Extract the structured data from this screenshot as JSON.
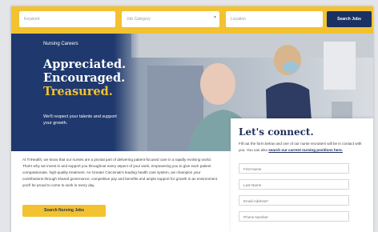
{
  "search_bar": {
    "keyword_placeholder": "Keyword",
    "category_placeholder": "Job Category",
    "location_placeholder": "Location",
    "search_button": "Search Jobs"
  },
  "hero": {
    "eyebrow": "Nursing Careers",
    "headline_1": "Appreciated.",
    "headline_2": "Encouraged.",
    "headline_3": "Treasured.",
    "subtext": "We'll respect your talents and support your growth."
  },
  "intro": {
    "body": "At TriHealth, we know that our nurses are a pivotal part of delivering patient-focused care in a rapidly evolving world. That's why we invest in and support you throughout every aspect of your work, empowering you to give each patient compassionate, high-quality treatment. As Greater Cincinnati's leading health care system, we champion your contributions through shared governance, competitive pay and benefits and ample support for growth in an environment you'll be proud to come to work in every day.",
    "cta_button": "Search Nursing Jobs"
  },
  "connect_form": {
    "title": "Let's connect.",
    "text": "Fill out the form below and one of our nurse recruiters will be in contact with you. You can also ",
    "link": "search our current nursing positions here.",
    "fields": [
      "First Name",
      "Last Name",
      "Email Address*",
      "Phone Number"
    ]
  },
  "colors": {
    "brand_navy": "#1f386d",
    "brand_yellow": "#f2c230"
  }
}
